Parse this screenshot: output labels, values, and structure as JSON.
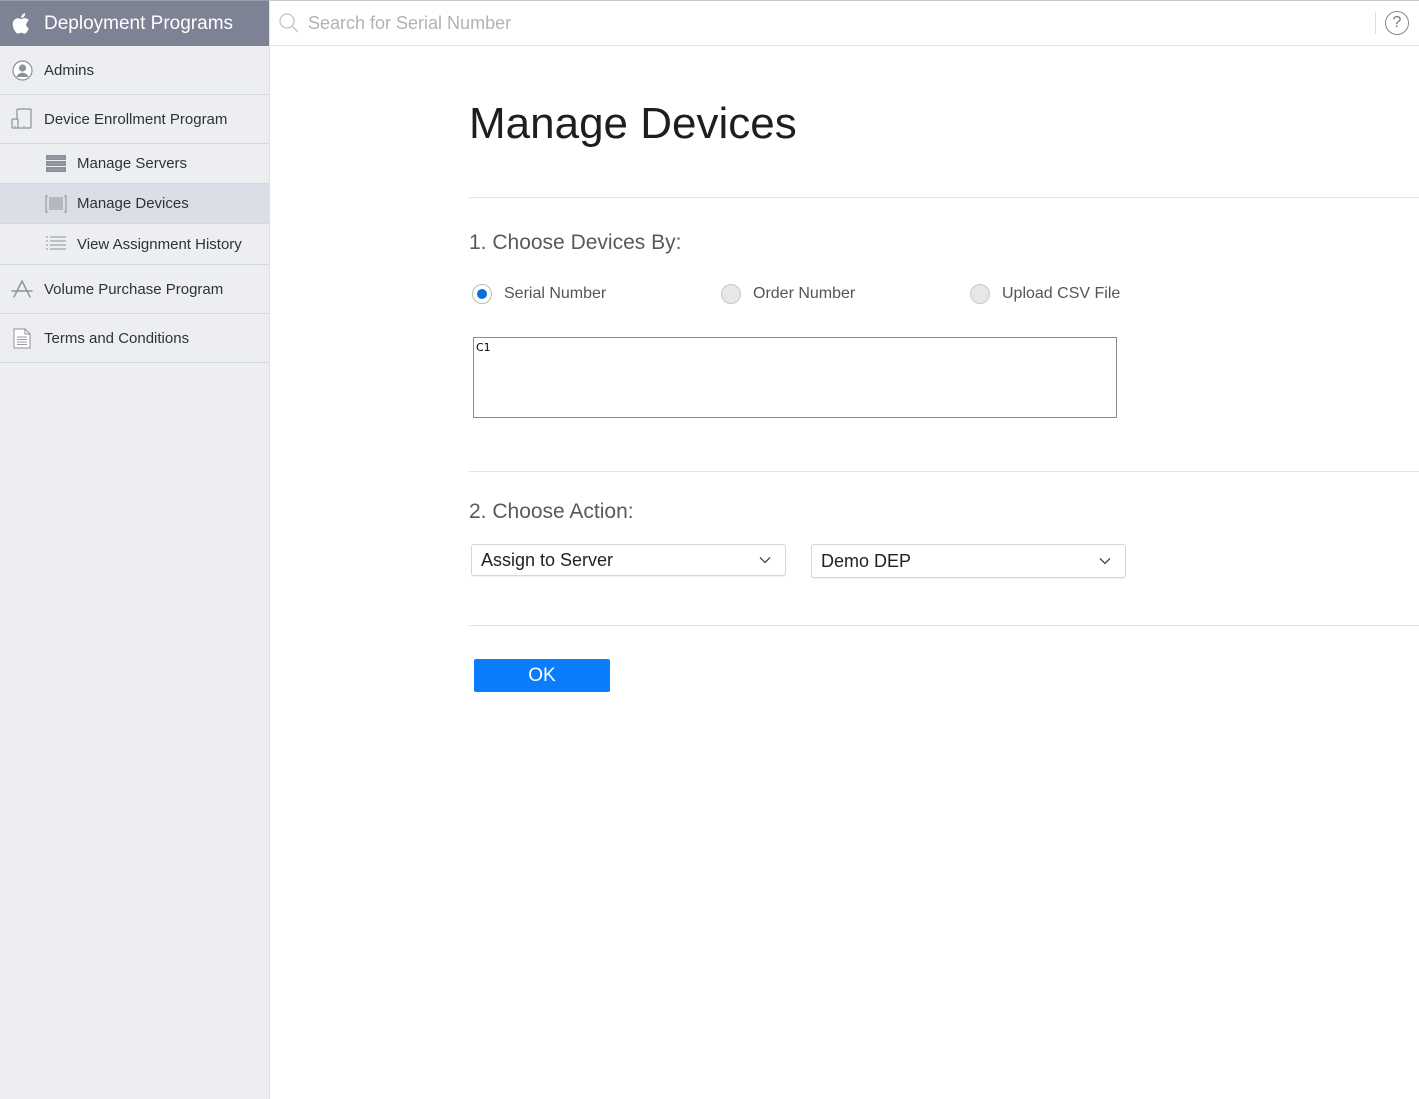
{
  "sidebar": {
    "brand": {
      "title": "Deployment Programs",
      "icon": "apple-icon"
    },
    "items": [
      {
        "label": "Admins",
        "icon": "user-circle-icon"
      },
      {
        "label": "Device Enrollment Program",
        "icon": "devices-icon",
        "children": [
          {
            "label": "Manage Servers",
            "icon": "server-icon"
          },
          {
            "label": "Manage Devices",
            "icon": "barcode-icon",
            "active": true
          },
          {
            "label": "View Assignment History",
            "icon": "list-icon"
          }
        ]
      },
      {
        "label": "Volume Purchase Program",
        "icon": "app-store-icon"
      },
      {
        "label": "Terms and Conditions",
        "icon": "document-icon"
      }
    ]
  },
  "topbar": {
    "search": {
      "placeholder": "Search for Serial Number",
      "value": ""
    },
    "help": "?"
  },
  "main": {
    "title": "Manage Devices",
    "section1": {
      "title": "1. Choose Devices By:",
      "options": [
        {
          "label": "Serial Number",
          "checked": true
        },
        {
          "label": "Order Number",
          "checked": false
        },
        {
          "label": "Upload CSV File",
          "checked": false
        }
      ],
      "serial_input_value": "C1"
    },
    "section2": {
      "title": "2. Choose Action:",
      "action_select": "Assign to Server",
      "server_select": "Demo DEP"
    },
    "ok_label": "OK"
  },
  "colors": {
    "brand_bar": "#7d8294",
    "accent": "#0b7cfb",
    "radio_checked": "#0a6fdc"
  }
}
